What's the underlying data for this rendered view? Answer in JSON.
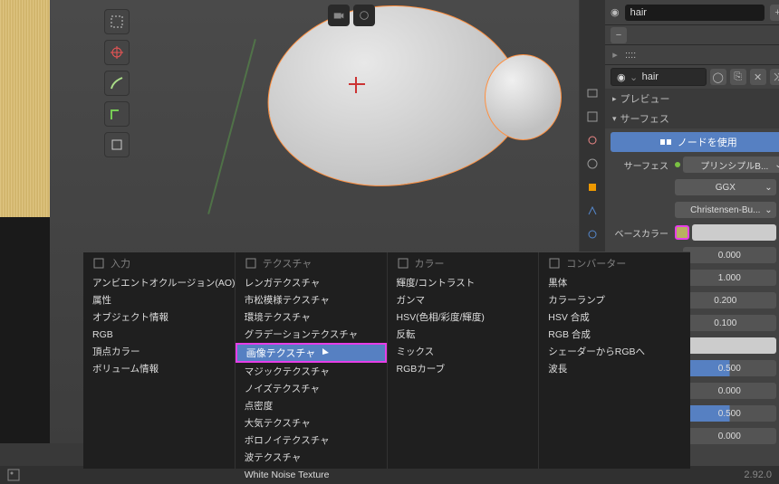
{
  "material_name": "hair",
  "material_selector": "hair",
  "sections": {
    "preview": "プレビュー",
    "surface": "サーフェス"
  },
  "use_nodes_btn": "ノードを使用",
  "surface_shader": {
    "label": "サーフェス",
    "value": "プリンシプルB..."
  },
  "props": {
    "ggx": "GGX",
    "christensen": "Christensen-Bu...",
    "base_color_label": "ベースカラー",
    "rows": [
      {
        "value": "0.000"
      },
      {
        "value": "1.000"
      },
      {
        "value": "0.200"
      },
      {
        "value": "0.100"
      }
    ],
    "shader_to_rgb_label": "シェーダーからRGBへ",
    "half": "0.500",
    "zero": "0.000",
    "half2": "0.500",
    "zero2": "0.000"
  },
  "menu": {
    "columns": [
      {
        "header": "入力",
        "icon": "img",
        "items": [
          "アンビエントオクルージョン(AO)",
          "属性",
          "オブジェクト情報",
          "RGB",
          "頂点カラー",
          "ボリューム情報"
        ]
      },
      {
        "header": "テクスチャ",
        "icon": "img",
        "items": [
          "レンガテクスチャ",
          "市松模様テクスチャ",
          "環境テクスチャ",
          "グラデーションテクスチャ",
          "画像テクスチャ",
          "マジックテクスチャ",
          "ノイズテクスチャ",
          "点密度",
          "大気テクスチャ",
          "ボロノイテクスチャ",
          "波テクスチャ",
          "White Noise Texture"
        ],
        "highlighted_index": 4
      },
      {
        "header": "カラー",
        "icon": "img",
        "items": [
          "輝度/コントラスト",
          "ガンマ",
          "HSV(色相/彩度/輝度)",
          "反転",
          "ミックス",
          "RGBカーブ"
        ]
      },
      {
        "header": "コンバーター",
        "icon": "img",
        "items": [
          "黒体",
          "カラーランプ",
          "HSV 合成",
          "RGB 合成",
          "シェーダーからRGBへ",
          "波長"
        ]
      }
    ]
  },
  "version": "2.92.0"
}
